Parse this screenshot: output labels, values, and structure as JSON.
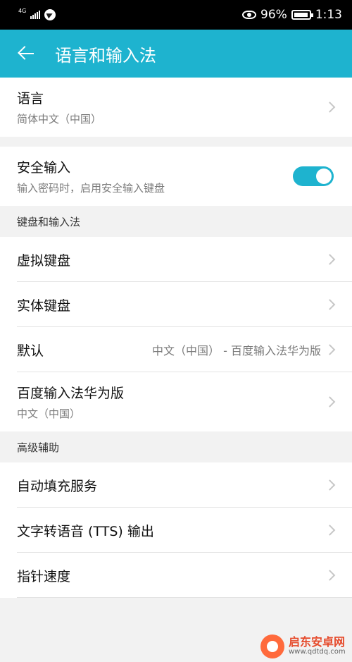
{
  "status": {
    "network": "4G",
    "battery": "96%",
    "battery_level": 0.96,
    "time": "1:13"
  },
  "appbar": {
    "title": "语言和输入法"
  },
  "language": {
    "title": "语言",
    "subtitle": "简体中文（中国）"
  },
  "secure_input": {
    "title": "安全输入",
    "subtitle": "输入密码时，启用安全输入键盘",
    "enabled": true
  },
  "keyboard_section": {
    "header": "键盘和输入法",
    "virtual": "虚拟键盘",
    "physical": "实体键盘",
    "default_label": "默认",
    "default_value": "中文（中国） - 百度输入法华为版",
    "baidu_title": "百度输入法华为版",
    "baidu_subtitle": "中文（中国）"
  },
  "advanced_section": {
    "header": "高级辅助",
    "autofill": "自动填充服务",
    "tts": "文字转语音 (TTS) 输出",
    "pointer": "指针速度"
  },
  "watermark": {
    "name": "启东安卓网",
    "url": "www.qdtdq.com"
  }
}
